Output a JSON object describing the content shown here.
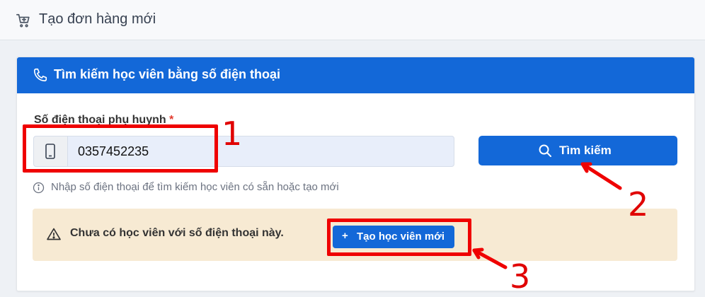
{
  "header": {
    "title": "Tạo đơn hàng mới",
    "icon": "cart-add-icon"
  },
  "search_card": {
    "title": "Tìm kiếm học viên bằng số điện thoại",
    "icon": "phone-icon",
    "field_label": "Số điện thoại phụ huynh",
    "required_mark": "*",
    "phone_value": "0357452235",
    "search_button": "Tìm kiếm",
    "hint": "Nhập số điện thoại để tìm kiếm học viên có sẵn hoặc tạo mới"
  },
  "alert": {
    "message": "Chưa có học viên với số điện thoại này.",
    "create_button_icon": "+",
    "create_button": "Tạo học viên mới"
  },
  "annotations": {
    "one": "1",
    "two": "2",
    "three": "3"
  },
  "colors": {
    "primary": "#1368d8",
    "warning_bg": "#f7ead3",
    "annotation": "#ef0000"
  }
}
